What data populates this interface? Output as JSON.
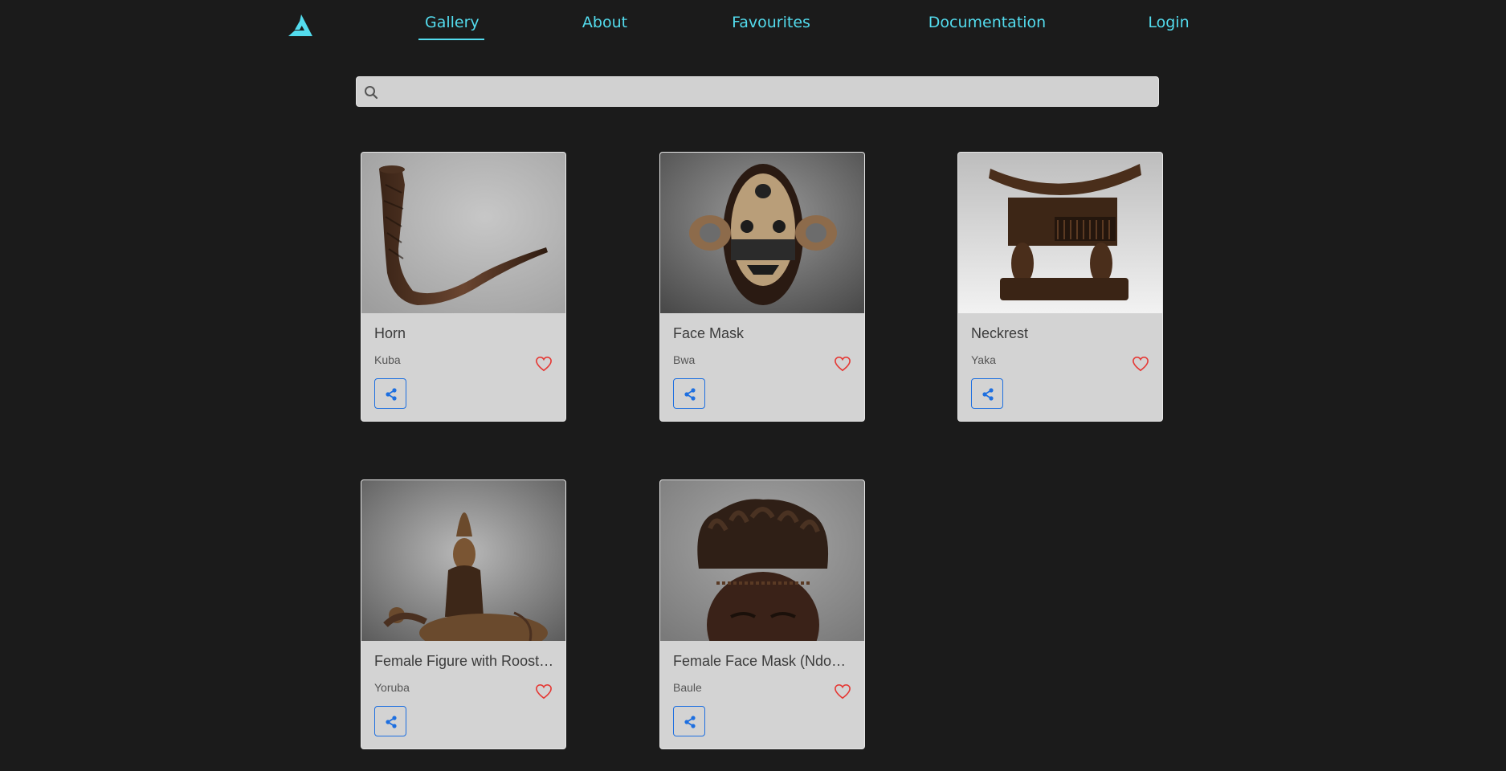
{
  "nav": {
    "items": [
      {
        "label": "Gallery",
        "active": true
      },
      {
        "label": "About"
      },
      {
        "label": "Favourites"
      },
      {
        "label": "Documentation"
      },
      {
        "label": "Login"
      }
    ]
  },
  "search": {
    "value": "",
    "placeholder": ""
  },
  "gallery": {
    "items": [
      {
        "title": "Horn",
        "culture": "Kuba",
        "icon_fav": "heart-outline-icon",
        "icon_share": "share-icon"
      },
      {
        "title": "Face Mask",
        "culture": "Bwa",
        "icon_fav": "heart-outline-icon",
        "icon_share": "share-icon"
      },
      {
        "title": "Neckrest",
        "culture": "Yaka",
        "icon_fav": "heart-outline-icon",
        "icon_share": "share-icon"
      },
      {
        "title": "Female Figure with Roost…",
        "culture": "Yoruba",
        "icon_fav": "heart-outline-icon",
        "icon_share": "share-icon"
      },
      {
        "title": "Female Face Mask (Ndo…",
        "culture": "Baule",
        "icon_fav": "heart-outline-icon",
        "icon_share": "share-icon"
      }
    ]
  },
  "colors": {
    "accent": "#53dcee",
    "heart": "#e53935",
    "share": "#1d6fe0",
    "background": "#1b1b1b",
    "card": "#d3d3d3"
  }
}
